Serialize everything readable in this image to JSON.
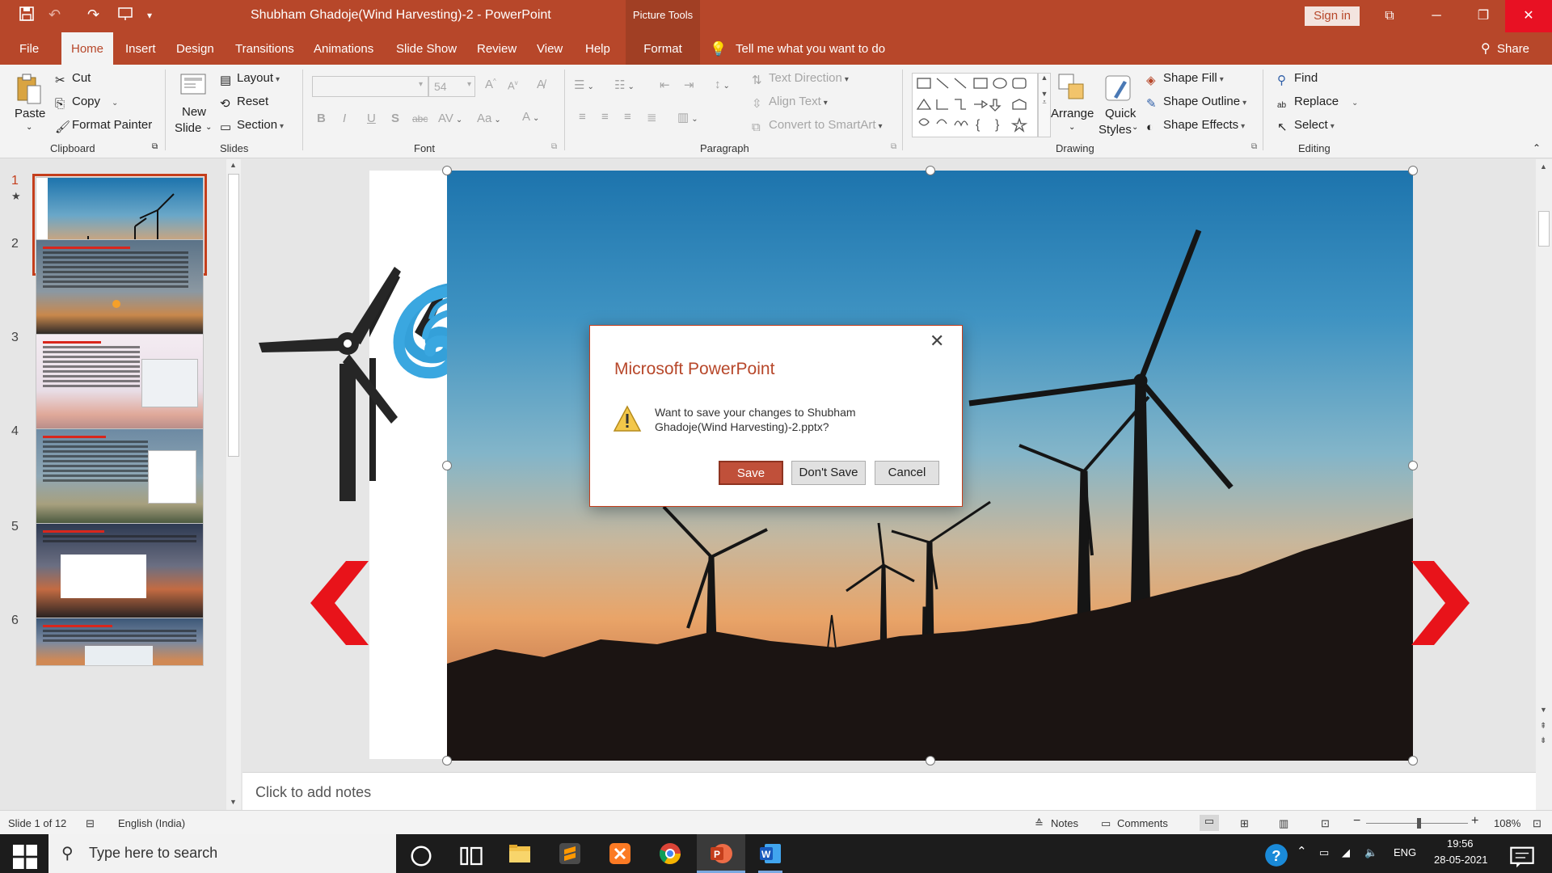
{
  "window": {
    "title": "Shubham Ghadoje(Wind Harvesting)-2  -  PowerPoint",
    "context_tools": "Picture Tools",
    "sign_in": "Sign in",
    "share": "Share"
  },
  "tabs": [
    "File",
    "Home",
    "Insert",
    "Design",
    "Transitions",
    "Animations",
    "Slide Show",
    "Review",
    "View",
    "Help",
    "Format"
  ],
  "tell_me": "Tell me what you want to do",
  "ribbon": {
    "clipboard": {
      "label": "Clipboard",
      "paste": "Paste",
      "cut": "Cut",
      "copy": "Copy",
      "format_painter": "Format Painter"
    },
    "slides": {
      "label": "Slides",
      "new_slide_1": "New",
      "new_slide_2": "Slide",
      "layout": "Layout",
      "reset": "Reset",
      "section": "Section"
    },
    "font": {
      "label": "Font",
      "font_name": "",
      "font_size": "54"
    },
    "paragraph": {
      "label": "Paragraph",
      "text_direction": "Text Direction",
      "align_text": "Align Text",
      "convert_smartart": "Convert to SmartArt"
    },
    "drawing": {
      "label": "Drawing",
      "arrange": "Arrange",
      "quick_styles_1": "Quick",
      "quick_styles_2": "Styles",
      "shape_fill": "Shape Fill",
      "shape_outline": "Shape Outline",
      "shape_effects": "Shape Effects"
    },
    "editing": {
      "label": "Editing",
      "find": "Find",
      "replace": "Replace",
      "select": "Select"
    }
  },
  "thumbnails": [
    {
      "num": "1",
      "star": "★"
    },
    {
      "num": "2"
    },
    {
      "num": "3"
    },
    {
      "num": "4"
    },
    {
      "num": "5"
    },
    {
      "num": "6"
    }
  ],
  "notes_placeholder": "Click to add notes",
  "dialog": {
    "title": "Microsoft PowerPoint",
    "message": "Want to save your changes to Shubham Ghadoje(Wind Harvesting)-2.pptx?",
    "save": "Save",
    "dont_save": "Don't Save",
    "cancel": "Cancel"
  },
  "status": {
    "slide_of": "Slide 1 of 12",
    "language": "English (India)",
    "notes": "Notes",
    "comments": "Comments",
    "zoom": "108%"
  },
  "taskbar": {
    "search_placeholder": "Type here to search",
    "lang": "ENG",
    "time": "19:56",
    "date": "28-05-2021"
  },
  "colors": {
    "accent": "#b7472a",
    "accent_dark": "#a13f24",
    "red_arrow": "#e8131a"
  }
}
